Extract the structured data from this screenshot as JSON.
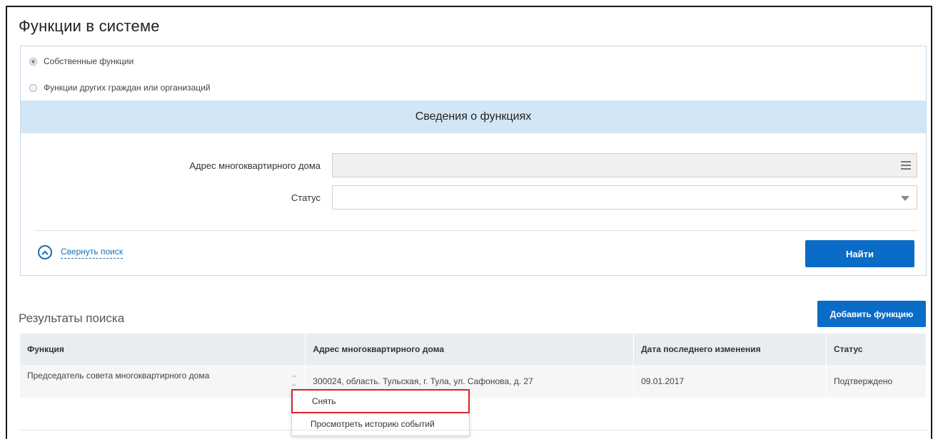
{
  "page": {
    "title": "Функции в системе"
  },
  "search": {
    "radio_options": [
      {
        "label": "Собственные функции",
        "checked": true
      },
      {
        "label": "Функции других граждан или организаций",
        "checked": false
      }
    ],
    "section_title": "Сведения о функциях",
    "fields": {
      "address_label": "Адрес многоквартирного дома",
      "address_value": "",
      "address_icon": "hamburger-icon",
      "status_label": "Статус",
      "status_value": "",
      "status_icon": "chevron-down-icon"
    },
    "collapse_label": "Свернуть поиск",
    "find_button": "Найти"
  },
  "results": {
    "title": "Результаты поиска",
    "add_button": "Добавить функцию",
    "columns": [
      "Функция",
      "Адрес многоквартирного дома",
      "Дата последнего изменения",
      "Статус"
    ],
    "rows": [
      {
        "function": "Председатель совета многоквартирного дома",
        "address": "300024, область. Тульская, г. Тула, ул. Сафонова, д. 27",
        "date": "09.01.2017",
        "status": "Подтверждено"
      }
    ]
  },
  "context_menu": {
    "items": [
      "Снять",
      "Просмотреть историю событий"
    ],
    "highlight_color": "#d8232a"
  },
  "colors": {
    "accent": "#0a6cc6",
    "section_header_bg": "#d3e6f6",
    "table_header_bg": "#e9edf1"
  }
}
